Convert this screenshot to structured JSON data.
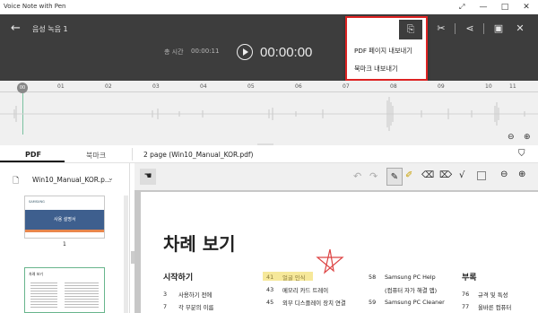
{
  "window": {
    "title": "Voice Note with Pen"
  },
  "header": {
    "title": "음성 녹음 1",
    "total_time_label": "총 시간",
    "total_time": "00:00:11",
    "current_time": "00:00:00"
  },
  "export_menu": {
    "items": [
      "PDF 페이지 내보내기",
      "북마크 내보내기"
    ],
    "highlight_color": "#dd2222"
  },
  "timeline": {
    "ticks": [
      "01",
      "02",
      "03",
      "04",
      "05",
      "06",
      "07",
      "08",
      "09",
      "10",
      "11"
    ],
    "cursor": "00"
  },
  "tabs": {
    "pdf": "PDF",
    "bookmark": "북마크",
    "page_info": "2 page (Win10_Manual_KOR.pdf)"
  },
  "left_panel": {
    "file_name": "Win10_Manual_KOR.p...",
    "thumb1_brand": "SAMSUNG",
    "thumb1_title": "사용 설명서",
    "thumb1_page": "1",
    "thumb2_title": "차례 보기"
  },
  "document": {
    "heading": "차례 보기",
    "section1": "시작하기",
    "section2": "부록",
    "col1": [
      {
        "num": "3",
        "text": "사용하기 전에"
      },
      {
        "num": "7",
        "text": "각 부분의 이름"
      }
    ],
    "col2": [
      {
        "num": "41",
        "text": "얼굴 인식"
      },
      {
        "num": "43",
        "text": "메모리 카드 트레이"
      },
      {
        "num": "45",
        "text": "외부 디스플레이 장치 연결"
      }
    ],
    "col3": [
      {
        "num": "58",
        "text": "Samsung PC Help"
      },
      {
        "num": "",
        "text": "(컴퓨터 자가 해결 앱)"
      },
      {
        "num": "59",
        "text": "Samsung PC Cleaner"
      }
    ],
    "col4": [
      {
        "num": "76",
        "text": "규격 및 특성"
      },
      {
        "num": "77",
        "text": "올바른 컴퓨터"
      }
    ]
  }
}
